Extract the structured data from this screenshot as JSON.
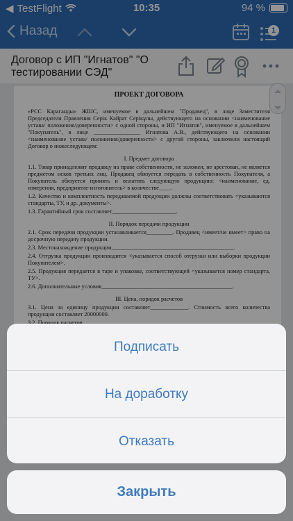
{
  "status_bar": {
    "carrier": "TestFlight",
    "time": "10:35",
    "battery": "94 %"
  },
  "navbar": {
    "back_label": "Назад",
    "badge_count": "1"
  },
  "document": {
    "title": "Договор с ИП \"Игнатов\" \"О тестировании СЭД\"",
    "page": {
      "heading": "ПРОЕКТ ДОГОВОРА",
      "intro": "«РСС Караганды» ЖШС, именуемое в дальнейшем \"Продавец\", в лице Заместителя Председателя Правления Серік Кайрат Серікұлы, действующего на основании <наименование устава/ положения/доверенности> с одной стороны, и ИП \"Игнатов\", именуемое в дальнейшем \"Покупатель\", в лице ________________ Игнатова А.В., действующего на основании <наименование устава/ положения/доверенности> с другой стороны, заключили настоящий Договор о нижеследующем:",
      "sec1": "I. Предмет договора",
      "p1_1": "1.1. Товар принадлежит продавцу на праве собственности, не заложен, не арестован, не является предметом исков третьих лиц. Продавец обязуется передать в собственность Покупателя, а Покупатель обязуется принять и оплатить следующую продукцию: <наименование, ед. измерения, предприятие-изготовитель> в количестве____.",
      "p1_2": "1.2. Качество и комплектность передаваемой продукции должны соответствовать <указываются стандарты, ТУ, и др. документы>.",
      "p1_3": "1.3. Гарантийный срок составляет______________________.",
      "sec2": "II. Порядок передачи продукции",
      "p2_1": "2.1. Срок передачи продукции устанавливается_________. Продавец <имеет/не имеет> право на досрочную передачу продукции.",
      "p2_3": "2.3. Местонахождение продукции__________________________________________.",
      "p2_4": "2.4. Отгрузка продукции производится <указывается способ отгрузки или выборки продукции Покупателем>.",
      "p2_5": "2.5. Продукция передается в таре и упаковке, соответствующей <указывается номер стандарта, ТУ>.",
      "p2_6": "2.6. Дополнительные условия_____________________________________________.",
      "sec3": "III. Цена, порядок расчетов",
      "p3_1": "3.1. Цена за единицу продукции составляет_____________. Стоимость всего количества продукции составляет 20000000.",
      "p3_2": "3.2. Порядок расчетов"
    }
  },
  "action_sheet": {
    "options": [
      "Подписать",
      "На доработку",
      "Отказать"
    ],
    "close_label": "Закрыть"
  },
  "colors": {
    "nav_blue": "#2e6cb3",
    "action_blue": "#3f7bbf"
  }
}
